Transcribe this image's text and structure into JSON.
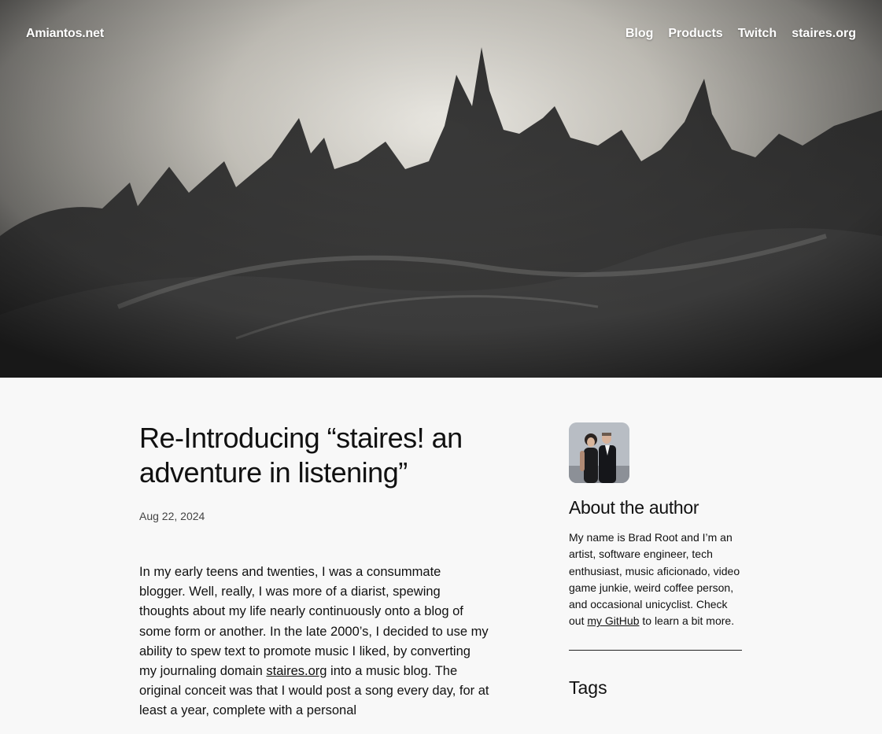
{
  "header": {
    "site_title": "Amiantos.net",
    "nav": [
      {
        "label": "Blog"
      },
      {
        "label": "Products"
      },
      {
        "label": "Twitch"
      },
      {
        "label": "staires.org"
      }
    ]
  },
  "post": {
    "title": "Re-Introducing “staires! an adventure in listening”",
    "date": "Aug 22, 2024",
    "body_before_link": "In my early teens and twenties, I was a consummate blogger. Well, really, I was more of a diarist, spewing thoughts about my life nearly continuously onto a blog of some form or another. In the late 2000’s, I decided to use my ability to spew text to promote music I liked, by converting my journaling domain ",
    "body_link": "staires.org",
    "body_after_link": " into a music blog. The original conceit was that I would post a song every day, for at least a year, complete with a personal"
  },
  "sidebar": {
    "avatar_icon": "author-photo",
    "about_heading": "About the author",
    "about_before_link": "My name is Brad Root and I’m an artist, software engineer, tech enthusiast, music aficionado, video game junkie, weird coffee person, and occasional unicyclist. Check out ",
    "about_link": "my GitHub",
    "about_after_link": " to learn a bit more.",
    "tags_heading": "Tags"
  },
  "colors": {
    "page_background": "#f8f8f8",
    "text": "#111111",
    "header_text": "#ffffff"
  }
}
